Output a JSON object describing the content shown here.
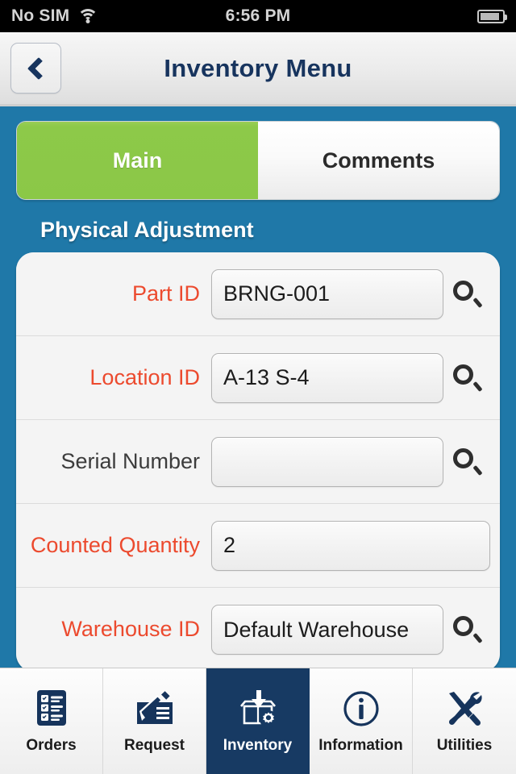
{
  "status_bar": {
    "carrier": "No SIM",
    "wifi_icon": "wifi-icon",
    "time": "6:56 PM",
    "battery_icon": "battery-icon"
  },
  "nav_bar": {
    "back_icon": "chevron-left-icon",
    "title": "Inventory Menu"
  },
  "segmented_control": {
    "tabs": [
      {
        "label": "Main",
        "active": true
      },
      {
        "label": "Comments",
        "active": false
      }
    ]
  },
  "form": {
    "section_title": "Physical Adjustment",
    "fields": [
      {
        "label": "Part ID",
        "value": "BRNG-001",
        "required": true,
        "has_search": true
      },
      {
        "label": "Location ID",
        "value": "A-13 S-4",
        "required": true,
        "has_search": true
      },
      {
        "label": "Serial Number",
        "value": "",
        "required": false,
        "has_search": true
      },
      {
        "label": "Counted Quantity",
        "value": "2",
        "required": true,
        "has_search": false
      },
      {
        "label": "Warehouse ID",
        "value": "Default Warehouse",
        "required": true,
        "has_search": true
      }
    ]
  },
  "tab_bar": {
    "items": [
      {
        "label": "Orders",
        "icon": "checklist-icon",
        "active": false
      },
      {
        "label": "Request",
        "icon": "pencil-form-icon",
        "active": false
      },
      {
        "label": "Inventory",
        "icon": "box-gear-icon",
        "active": true
      },
      {
        "label": "Information",
        "icon": "info-circle-icon",
        "active": false
      },
      {
        "label": "Utilities",
        "icon": "tools-icon",
        "active": false
      }
    ]
  },
  "colors": {
    "background_blue": "#1f78a8",
    "active_green": "#8dc949",
    "required_red": "#ec4a2e",
    "navy": "#16345c",
    "active_tab_navy": "#173a63"
  }
}
